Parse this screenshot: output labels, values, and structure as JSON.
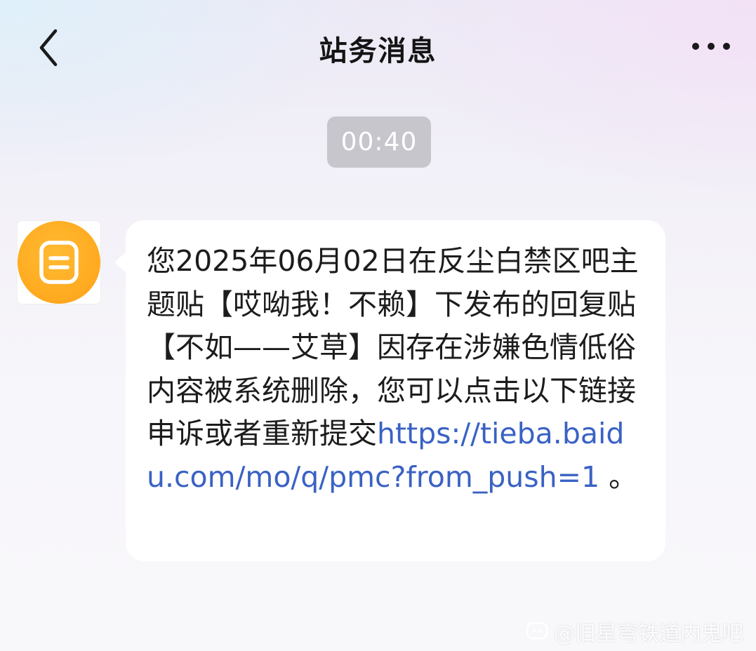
{
  "header": {
    "title": "站务消息",
    "back_icon": "chevron-left-icon",
    "more_icon": "more-horizontal-icon"
  },
  "timestamp": "00:40",
  "message": {
    "sender_icon": "document-icon",
    "sender_color": "#FFAC22",
    "body": "您2025年06月02日在反尘白禁区吧主题贴【哎呦我！不赖】下发布的回复贴【不如——艾草】因存在涉嫌色情低俗内容被系统删除，您可以点击以下链接申诉或者重新提交",
    "link": "https://tieba.baidu.com/mo/q/pmc?from_push=1",
    "end_punct": " 。"
  },
  "watermark": {
    "text": "@旧星穹铁道内鬼吧",
    "icon": "weibo-logo-icon"
  },
  "colors": {
    "link": "#3A62C4",
    "pill_bg": "#C8C6CD",
    "bubble_bg": "#FFFFFF"
  }
}
